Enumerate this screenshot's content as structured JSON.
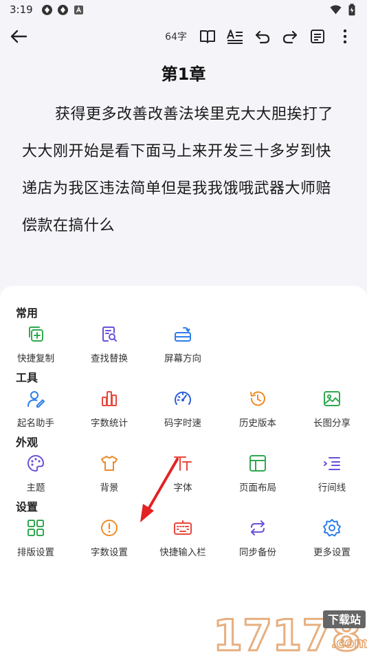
{
  "status_bar": {
    "time": "3:19"
  },
  "toolbar": {
    "word_count": "64字"
  },
  "chapter": {
    "title": "第1章",
    "body": "获得更多改善改善法埃里克大大胆挨打了大大刚开始是看下面马上来开发三十多岁到快递店为我区违法简单但是我我饿哦武器大师赔偿款在搞什么"
  },
  "sections": [
    {
      "title": "常用",
      "items": [
        {
          "label": "快捷复制",
          "icon": "copy-add-icon",
          "color": "#2fa84f"
        },
        {
          "label": "查找替换",
          "icon": "find-replace-icon",
          "color": "#6a4fd8"
        },
        {
          "label": "屏幕方向",
          "icon": "screen-rotate-icon",
          "color": "#2b7de9"
        }
      ]
    },
    {
      "title": "工具",
      "items": [
        {
          "label": "起名助手",
          "icon": "user-edit-icon",
          "color": "#2b7de9"
        },
        {
          "label": "字数统计",
          "icon": "bar-chart-icon",
          "color": "#e8473b"
        },
        {
          "label": "码字时速",
          "icon": "speedometer-icon",
          "color": "#2b5cd8"
        },
        {
          "label": "历史版本",
          "icon": "history-icon",
          "color": "#f08a24"
        },
        {
          "label": "长图分享",
          "icon": "image-icon",
          "color": "#2fa84f"
        }
      ]
    },
    {
      "title": "外观",
      "items": [
        {
          "label": "主题",
          "icon": "palette-icon",
          "color": "#6a4fd8"
        },
        {
          "label": "背景",
          "icon": "tshirt-icon",
          "color": "#f08a24"
        },
        {
          "label": "字体",
          "icon": "font-icon",
          "color": "#e8473b"
        },
        {
          "label": "页面布局",
          "icon": "layout-icon",
          "color": "#2fa84f"
        },
        {
          "label": "行间线",
          "icon": "line-spacing-icon",
          "color": "#6a4fd8"
        }
      ]
    },
    {
      "title": "设置",
      "items": [
        {
          "label": "排版设置",
          "icon": "grid-layout-icon",
          "color": "#2fa84f"
        },
        {
          "label": "字数设置",
          "icon": "alert-circle-icon",
          "color": "#f08a24"
        },
        {
          "label": "快捷输入栏",
          "icon": "keyboard-icon",
          "color": "#e8473b"
        },
        {
          "label": "同步备份",
          "icon": "sync-icon",
          "color": "#6a4fd8"
        },
        {
          "label": "更多设置",
          "icon": "gear-icon",
          "color": "#2b7de9"
        }
      ]
    }
  ],
  "watermark": {
    "number": "17178",
    "badge": "下载站",
    "domain": ".com"
  }
}
